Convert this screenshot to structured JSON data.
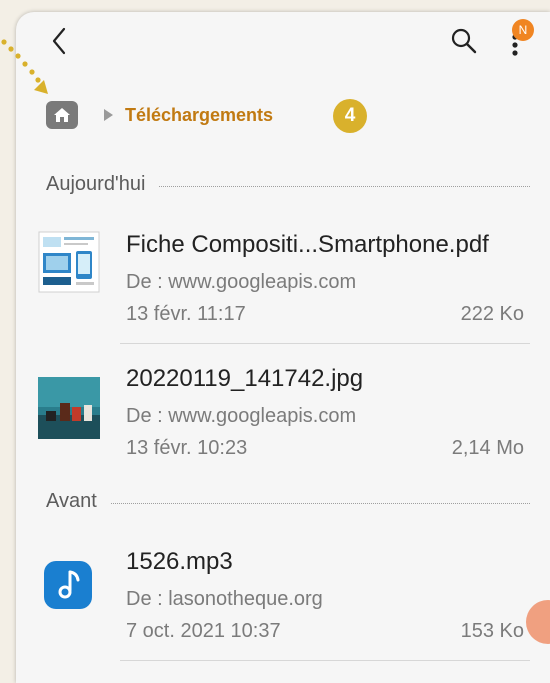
{
  "header": {
    "notification_badge": "N",
    "step_badge": "4"
  },
  "breadcrumb": {
    "current": "Téléchargements"
  },
  "sections": [
    {
      "title": "Aujourd'hui"
    },
    {
      "title": "Avant"
    }
  ],
  "files": [
    {
      "name": "Fiche Compositi...Smartphone.pdf",
      "source": "De : www.googleapis.com",
      "date": "13 févr. 11:17",
      "size": "222 Ko",
      "thumb_icon": "pdf-document-thumbnail"
    },
    {
      "name": "20220119_141742.jpg",
      "source": "De : www.googleapis.com",
      "date": "13 févr. 10:23",
      "size": "2,14 Mo",
      "thumb_icon": "photo-thumbnail"
    },
    {
      "name": "1526.mp3",
      "source": "De : lasonotheque.org",
      "date": "7 oct. 2021 10:37",
      "size": "153 Ko",
      "thumb_icon": "music-note-icon"
    }
  ],
  "colors": {
    "accent_orange": "#c17a12",
    "step_badge": "#d9b12c",
    "notif_badge": "#f08522",
    "music_icon_bg": "#1a7fd0"
  }
}
